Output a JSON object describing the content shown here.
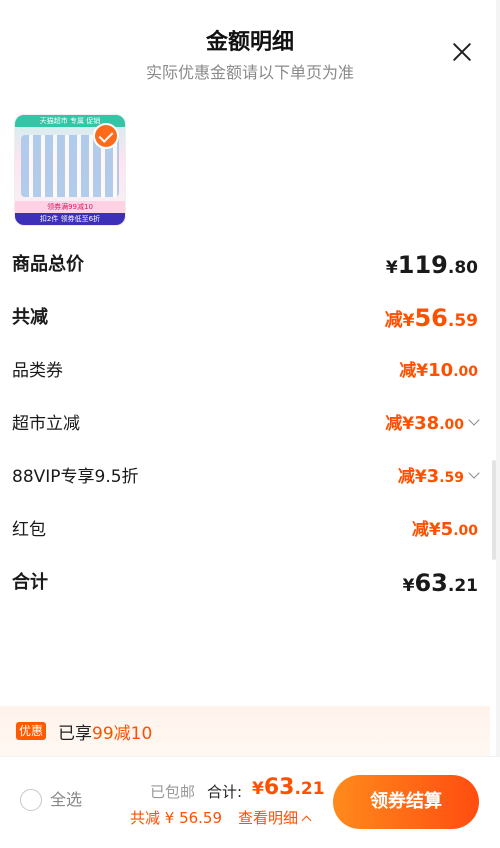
{
  "header": {
    "title": "金额明细",
    "subtitle": "实际优惠金额请以下单页为准"
  },
  "product": {
    "topbar": "天猫超市 专属 促销",
    "brand": "领券满99减10",
    "footer": "扣2件  领券低至6折",
    "selected": true
  },
  "rows": [
    {
      "label": "商品总价",
      "prefix": "",
      "currency": "¥",
      "int": "119",
      "dec": ".80",
      "style": "total",
      "expandable": false
    },
    {
      "label": "共减",
      "prefix": "减",
      "currency": "¥",
      "int": "56",
      "dec": ".59",
      "style": "discount-big",
      "expandable": false
    },
    {
      "label": "品类券",
      "prefix": "减",
      "currency": "¥",
      "int": "10",
      "dec": ".00",
      "style": "discount",
      "expandable": false
    },
    {
      "label": "超市立减",
      "prefix": "减",
      "currency": "¥",
      "int": "38",
      "dec": ".00",
      "style": "discount",
      "expandable": true
    },
    {
      "label": "88VIP专享9.5折",
      "prefix": "减",
      "currency": "¥",
      "int": "3",
      "dec": ".59",
      "style": "discount",
      "expandable": true
    },
    {
      "label": "红包",
      "prefix": "减",
      "currency": "¥",
      "int": "5",
      "dec": ".00",
      "style": "discount",
      "expandable": false
    },
    {
      "label": "合计",
      "prefix": "",
      "currency": "¥",
      "int": "63",
      "dec": ".21",
      "style": "total",
      "expandable": false
    }
  ],
  "promo": {
    "tag": "优惠",
    "text_prefix": "已享",
    "text_highlight": "99减10"
  },
  "footer": {
    "select_all": "全选",
    "shipping": "已包邮",
    "total_label": "合计:",
    "total_currency": "¥",
    "total_int": "63",
    "total_dec": ".21",
    "discount": "共减 ¥ 56.59",
    "view_detail": "查看明细",
    "checkout": "领券结算"
  },
  "colors": {
    "accent": "#ff5000",
    "checkout_gradient_start": "#ff8a1c",
    "checkout_gradient_end": "#ff4d10"
  }
}
